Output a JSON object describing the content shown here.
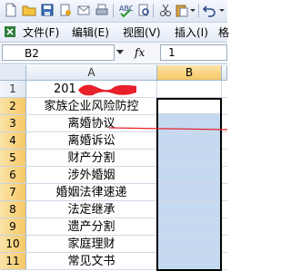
{
  "menu": {
    "file": "文件(F)",
    "edit": "编辑(E)",
    "view": "视图(V)",
    "insert": "插入(I)",
    "format": "格"
  },
  "formula_bar": {
    "name_box": "B2",
    "fx_label": "fx",
    "value": "1"
  },
  "columns": {
    "a": "A",
    "b": "B"
  },
  "rows": [
    {
      "num": "1",
      "a": "201"
    },
    {
      "num": "2",
      "a": "家族企业风险防控"
    },
    {
      "num": "3",
      "a": "离婚协议"
    },
    {
      "num": "4",
      "a": "离婚诉讼"
    },
    {
      "num": "5",
      "a": "财产分割"
    },
    {
      "num": "6",
      "a": "涉外婚姻"
    },
    {
      "num": "7",
      "a": "婚姻法律速递"
    },
    {
      "num": "8",
      "a": "法定继承"
    },
    {
      "num": "9",
      "a": "遗产分割"
    },
    {
      "num": "10",
      "a": "家庭理财"
    },
    {
      "num": "11",
      "a": "常见文书"
    }
  ],
  "colors": {
    "accent_selection": "#c5daf0",
    "header_highlight": "#f6c865",
    "annotation_red": "#e8202a"
  }
}
